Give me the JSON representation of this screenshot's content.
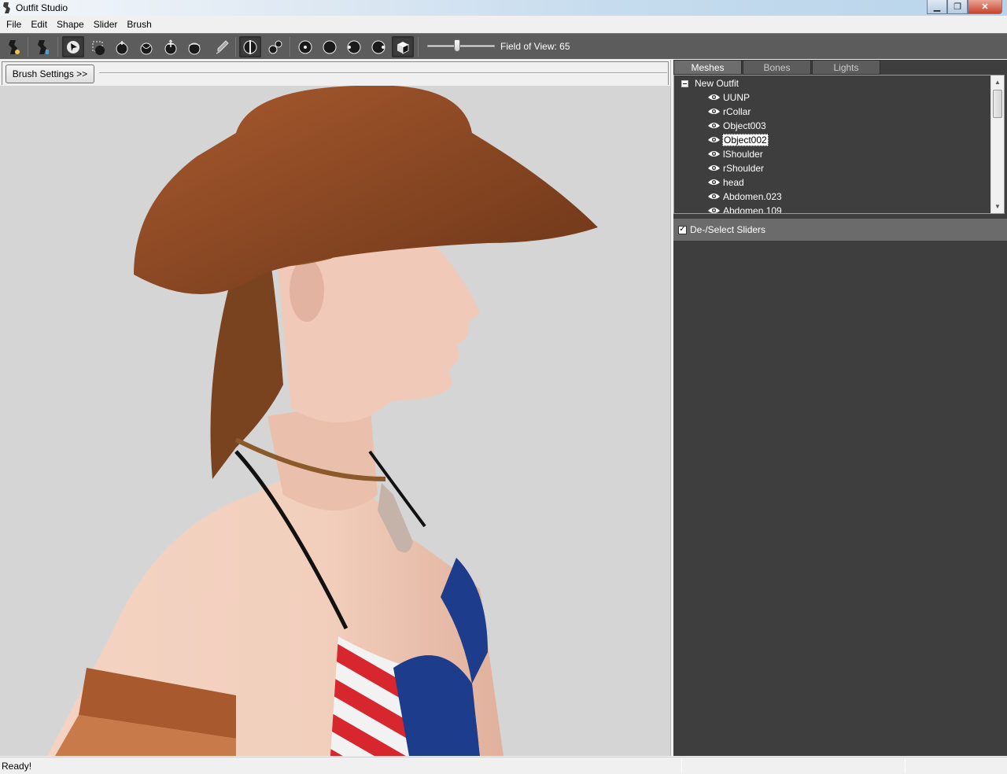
{
  "window": {
    "title": "Outfit Studio"
  },
  "menu": [
    "File",
    "Edit",
    "Shape",
    "Slider",
    "Brush"
  ],
  "toolbar": {
    "tools": [
      {
        "name": "project-icon"
      },
      {
        "name": "load-reference-icon"
      },
      {
        "name": "select-brush-icon",
        "active": true
      },
      {
        "name": "mask-brush-icon"
      },
      {
        "name": "inflate-brush-icon"
      },
      {
        "name": "deflate-brush-icon"
      },
      {
        "name": "move-brush-icon"
      },
      {
        "name": "smooth-brush-icon"
      },
      {
        "name": "weight-brush-icon"
      },
      {
        "name": "x-mirror-icon",
        "active": true
      },
      {
        "name": "connected-only-icon"
      },
      {
        "name": "front-view-icon"
      },
      {
        "name": "back-view-icon"
      },
      {
        "name": "left-view-icon"
      },
      {
        "name": "right-view-icon"
      },
      {
        "name": "perspective-toggle-icon",
        "active": true
      }
    ],
    "fov_label": "Field of View: 65",
    "fov_value": 65
  },
  "brush": {
    "settings_label": "Brush Settings >>"
  },
  "tabs": [
    {
      "label": "Meshes",
      "active": true
    },
    {
      "label": "Bones",
      "active": false
    },
    {
      "label": "Lights",
      "active": false
    }
  ],
  "tree": {
    "root": "New Outfit",
    "meshes": [
      "UUNP",
      "rCollar",
      "Object003",
      "Object002",
      "lShoulder",
      "rShoulder",
      "head",
      "Abdomen.023",
      "Abdomen.109"
    ],
    "selected_index": 3
  },
  "sliders": {
    "deselect_label": "De-/Select Sliders",
    "checked": true
  },
  "status": {
    "text": "Ready!"
  },
  "colors": {
    "toolbar_bg": "#5c5c5c",
    "panel_bg": "#3e3e3e",
    "viewport_bg": "#d5d5d5"
  }
}
